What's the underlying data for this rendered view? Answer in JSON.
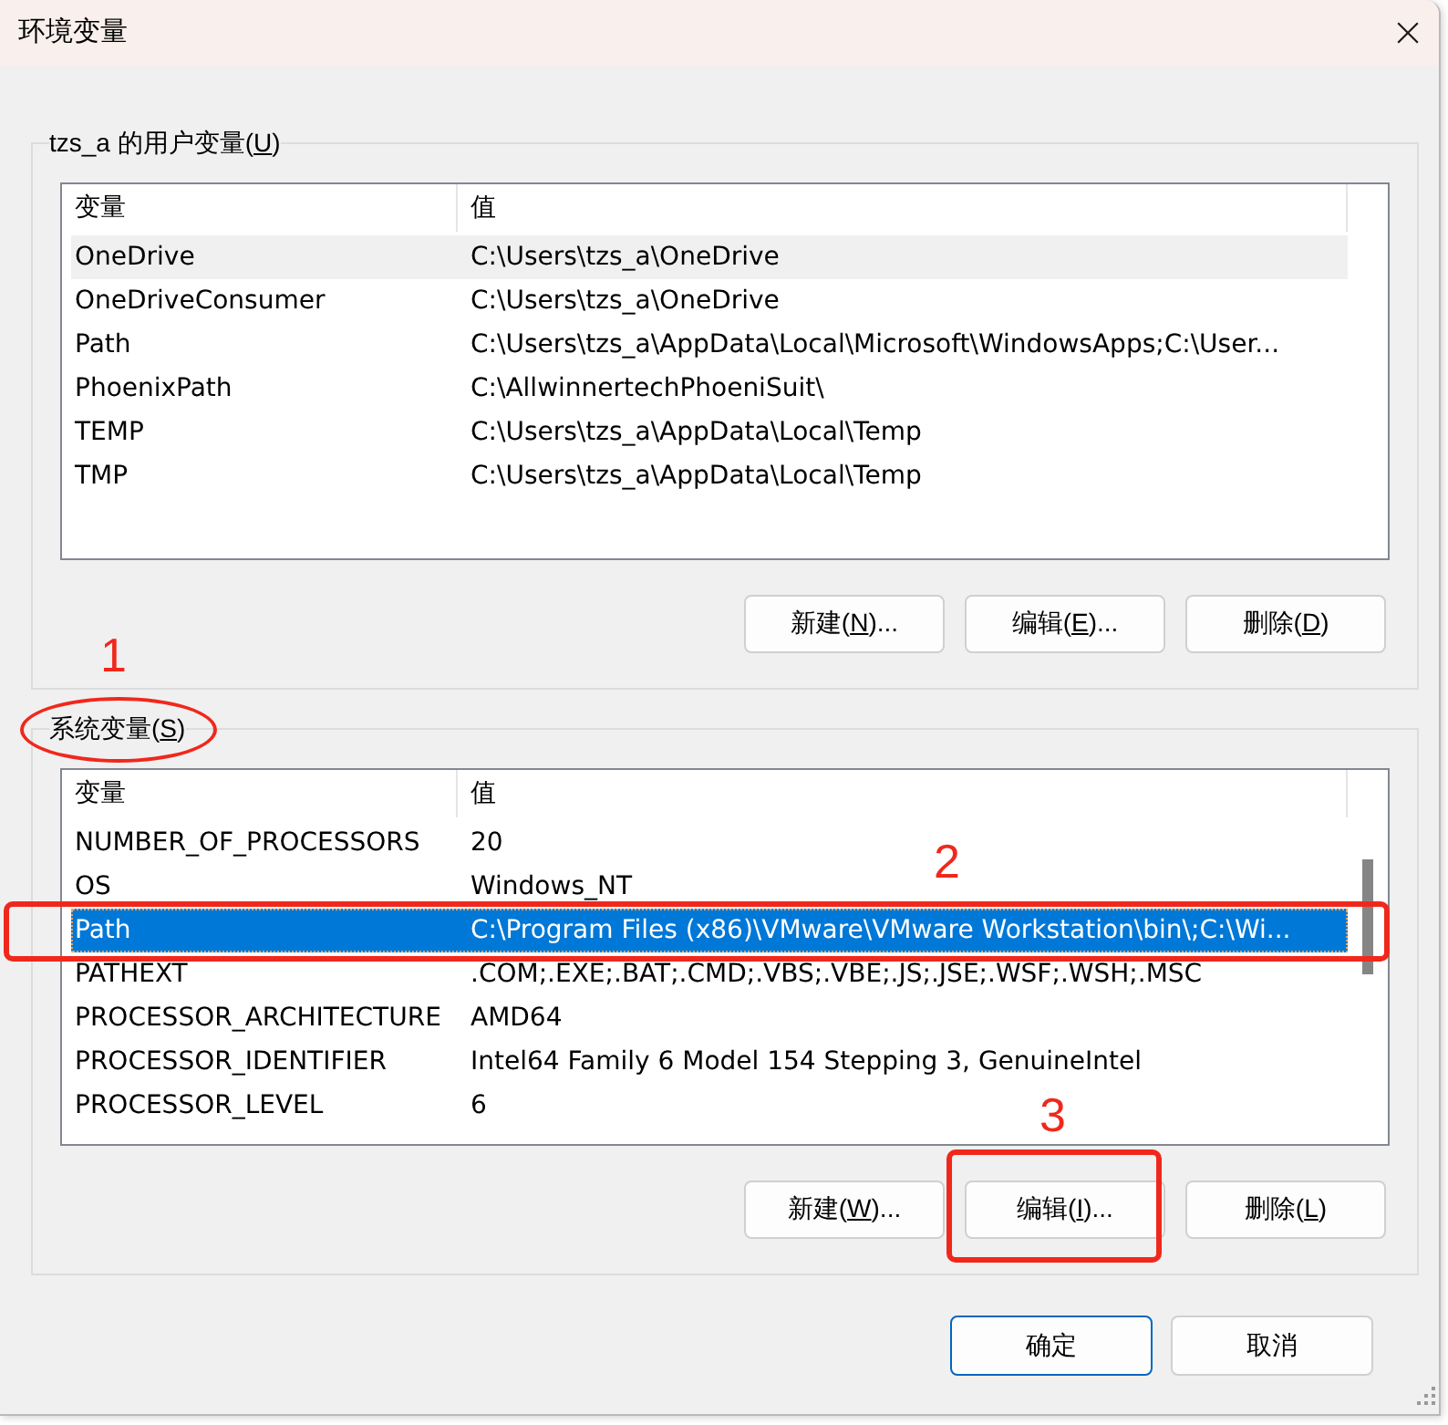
{
  "window": {
    "title": "环境变量"
  },
  "user_variables": {
    "label": "tzs_a 的用户变量(",
    "access_key": "U",
    "label_end": ")",
    "focused": false,
    "scrollbar": false,
    "columns": [
      "变量",
      "值"
    ],
    "rows": [
      {
        "name": "OneDrive",
        "value": "C:\\Users\\tzs_a\\OneDrive",
        "selected": true
      },
      {
        "name": "OneDriveConsumer",
        "value": "C:\\Users\\tzs_a\\OneDrive",
        "selected": false
      },
      {
        "name": "Path",
        "value": "C:\\Users\\tzs_a\\AppData\\Local\\Microsoft\\WindowsApps;C:\\User...",
        "selected": false
      },
      {
        "name": "PhoenixPath",
        "value": "C:\\AllwinnertechPhoeniSuit\\",
        "selected": false
      },
      {
        "name": "TEMP",
        "value": "C:\\Users\\tzs_a\\AppData\\Local\\Temp",
        "selected": false
      },
      {
        "name": "TMP",
        "value": "C:\\Users\\tzs_a\\AppData\\Local\\Temp",
        "selected": false
      }
    ],
    "buttons": [
      {
        "label": "新建(",
        "access_key": "N",
        "label_end": ")..."
      },
      {
        "label": "编辑(",
        "access_key": "E",
        "label_end": ")..."
      },
      {
        "label": "删除(",
        "access_key": "D",
        "label_end": ")"
      }
    ]
  },
  "system_variables": {
    "label": "系统变量(",
    "access_key": "S",
    "label_end": ")",
    "focused": true,
    "scrollbar": true,
    "columns": [
      "变量",
      "值"
    ],
    "rows": [
      {
        "name": "NUMBER_OF_PROCESSORS",
        "value": "20",
        "selected": false
      },
      {
        "name": "OS",
        "value": "Windows_NT",
        "selected": false
      },
      {
        "name": "Path",
        "value": "C:\\Program Files (x86)\\VMware\\VMware Workstation\\bin\\;C:\\Wi...",
        "selected": true
      },
      {
        "name": "PATHEXT",
        "value": ".COM;.EXE;.BAT;.CMD;.VBS;.VBE;.JS;.JSE;.WSF;.WSH;.MSC",
        "selected": false
      },
      {
        "name": "PROCESSOR_ARCHITECTURE",
        "value": "AMD64",
        "selected": false
      },
      {
        "name": "PROCESSOR_IDENTIFIER",
        "value": "Intel64 Family 6 Model 154 Stepping 3, GenuineIntel",
        "selected": false
      },
      {
        "name": "PROCESSOR_LEVEL",
        "value": "6",
        "selected": false
      }
    ],
    "buttons": [
      {
        "label": "新建(",
        "access_key": "W",
        "label_end": ")..."
      },
      {
        "label": "编辑(",
        "access_key": "I",
        "label_end": ")..."
      },
      {
        "label": "删除(",
        "access_key": "L",
        "label_end": ")"
      }
    ]
  },
  "dialog_buttons": [
    {
      "label": "确定",
      "default": true
    },
    {
      "label": "取消",
      "default": false
    }
  ],
  "annotations": [
    {
      "number": "1",
      "kind": "ellipse"
    },
    {
      "number": "2",
      "kind": "rectangle"
    },
    {
      "number": "3",
      "kind": "rectangle"
    }
  ]
}
